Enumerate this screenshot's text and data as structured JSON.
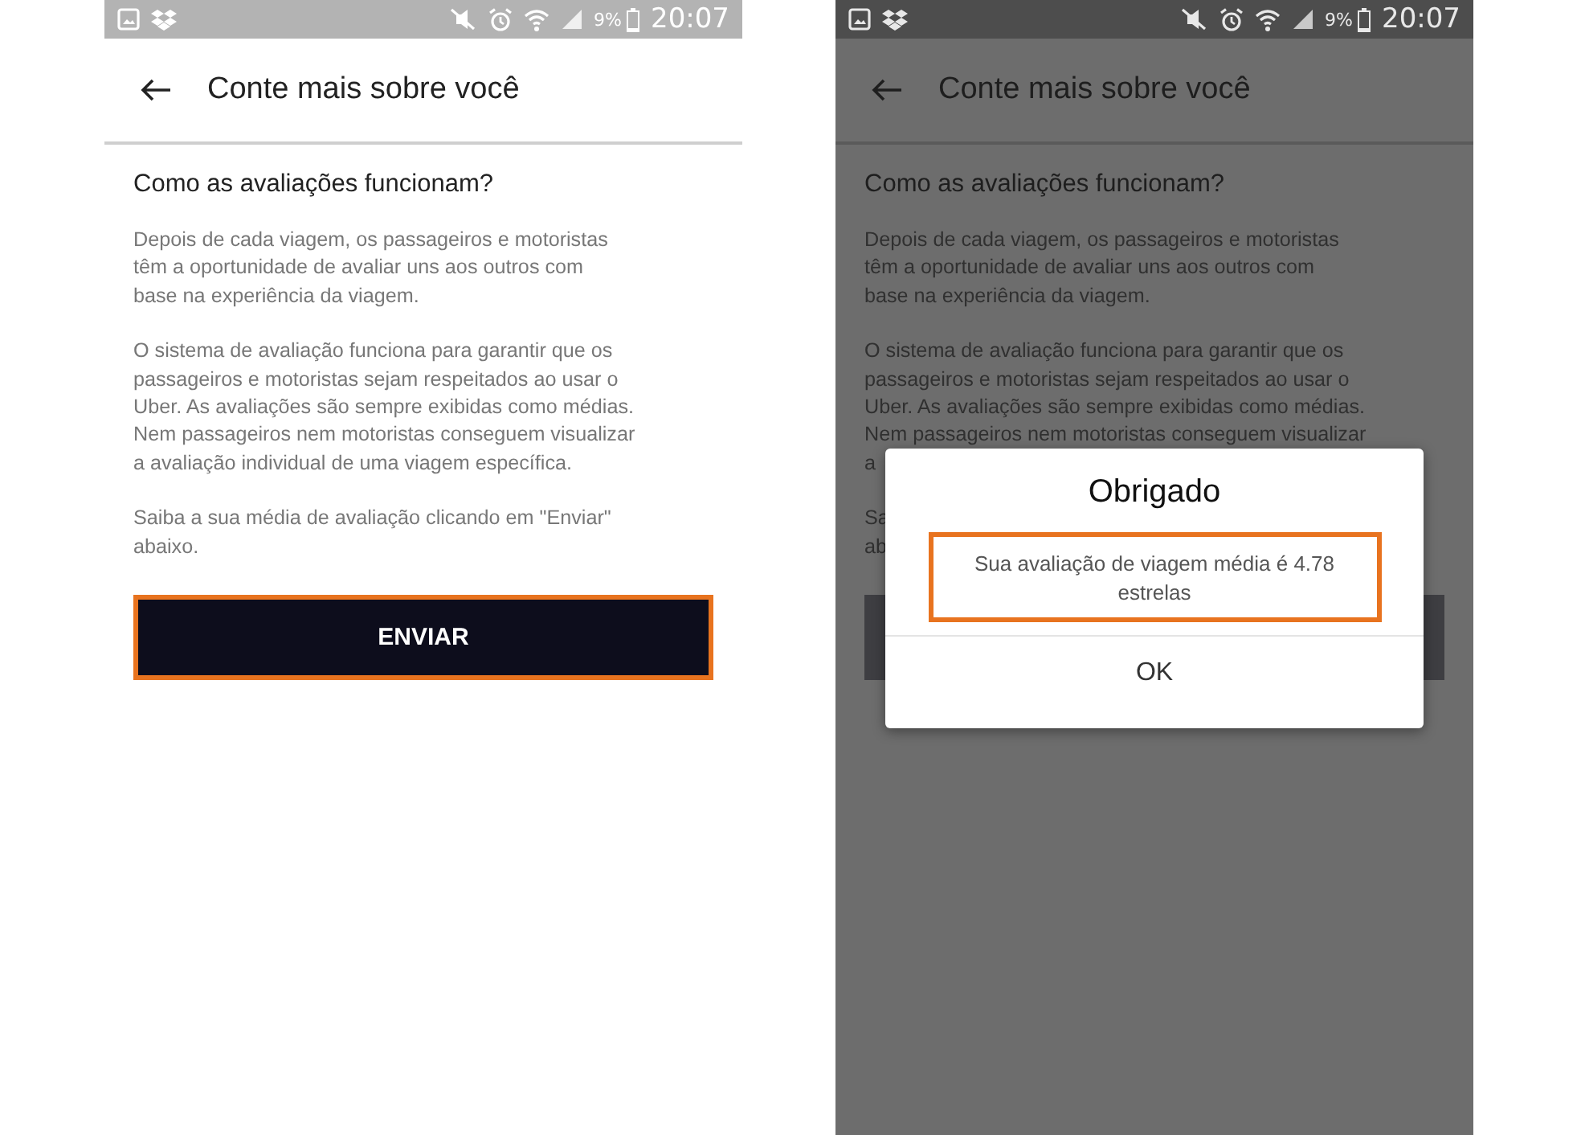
{
  "screens": [
    {
      "dimmed": false,
      "status_bar": {
        "battery": "9%",
        "time": "20:07"
      },
      "header": {
        "title": "Conte mais sobre você"
      },
      "heading": "Como as avaliações funcionam?",
      "paragraphs": [
        [
          "Depois de cada viagem, os passageiros e motoristas",
          "têm a oportunidade de avaliar uns aos outros com",
          "base na experiência da viagem."
        ],
        [
          "O sistema de avaliação funciona para garantir que os",
          "passageiros e motoristas sejam respeitados ao usar o",
          "Uber. As avaliações são sempre exibidas como médias.",
          "Nem passageiros nem motoristas conseguem visualizar",
          "a avaliação individual de uma viagem específica."
        ],
        [
          "Saiba a sua média de avaliação clicando em \"Enviar\"",
          "abaixo."
        ]
      ],
      "button": {
        "label": "ENVIAR",
        "highlighted": true
      }
    },
    {
      "dimmed": true,
      "status_bar": {
        "battery": "9%",
        "time": "20:07"
      },
      "header": {
        "title": "Conte mais sobre você"
      },
      "heading": "Como as avaliações funcionam?",
      "paragraphs": [
        [
          "Depois de cada viagem, os passageiros e motoristas",
          "têm a oportunidade de avaliar uns aos outros com",
          "base na experiência da viagem."
        ],
        [
          "O sistema de avaliação funciona para garantir que os",
          "passageiros e motoristas sejam respeitados ao usar o",
          "Uber. As avaliações são sempre exibidas como médias.",
          "Nem passageiros nem motoristas conseguem visualizar",
          "a"
        ],
        [
          "Sa",
          "ab"
        ]
      ],
      "button": {
        "highlighted": false
      },
      "dialog": {
        "title": "Obrigado",
        "message": "Sua avaliação de viagem média é 4.78 estrelas",
        "message_highlighted": true,
        "action": "OK"
      }
    }
  ]
}
